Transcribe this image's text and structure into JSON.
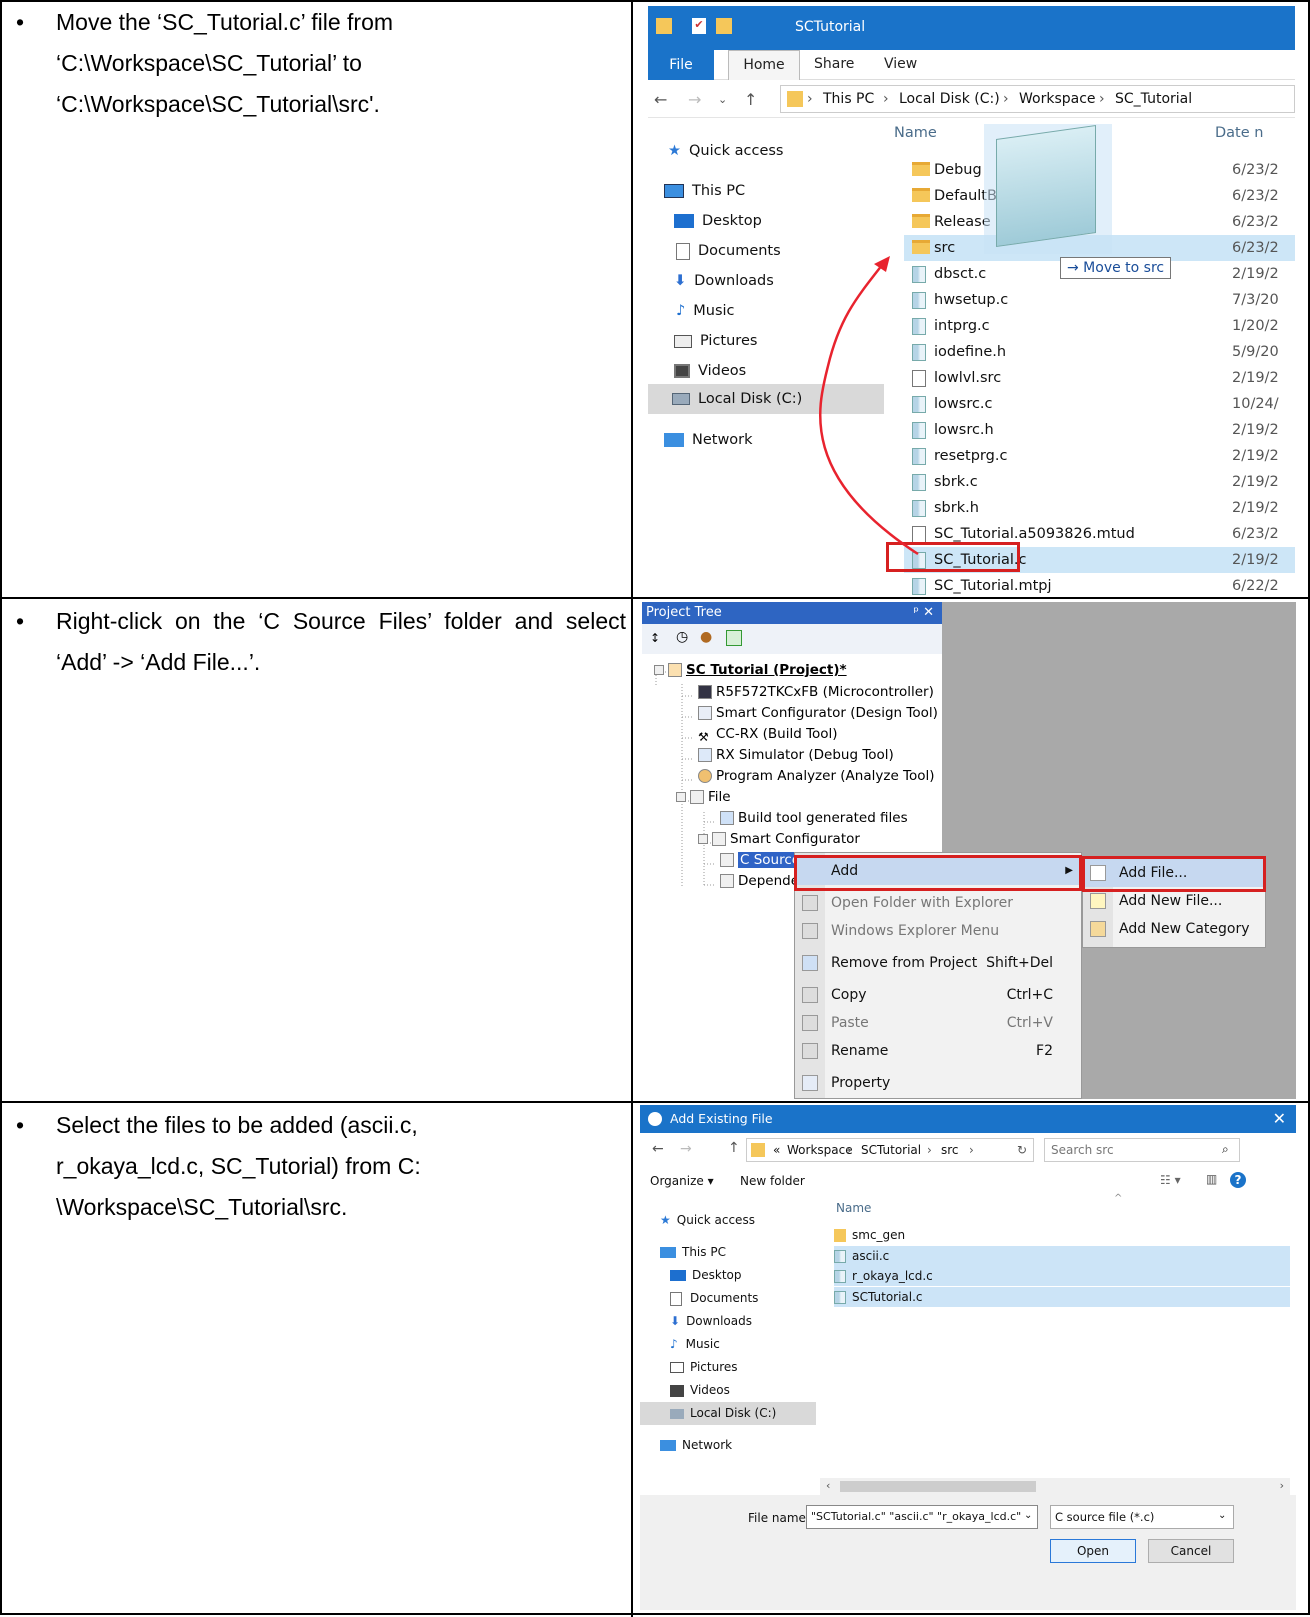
{
  "rows": [
    {
      "bullet": "•",
      "text": "Move the ‘SC_Tutorial.c’ file from ‘C:\\Workspace\\SC_Tutorial’ to ‘C:\\Workspace\\SC_Tutorial\\src'."
    },
    {
      "bullet": "•",
      "text": "Right-click on the ‘C Source Files’ folder and select ‘Add’ -> ‘Add File...’."
    },
    {
      "bullet": "•",
      "text": "Select the files to be added (ascii.c, r_okaya_lcd.c, SC_Tutorial) from C: \\Workspace\\SC_Tutorial\\src."
    }
  ],
  "explorer": {
    "title": "SCTutorial",
    "tabs": [
      "File",
      "Home",
      "Share",
      "View"
    ],
    "breadcrumb": [
      "This PC",
      "Local Disk (C:)",
      "Workspace",
      "SC_Tutorial"
    ],
    "nav": [
      "Quick access",
      "This PC",
      "Desktop",
      "Documents",
      "Downloads",
      "Music",
      "Pictures",
      "Videos",
      "Local Disk (C:)",
      "Network"
    ],
    "col_name": "Name",
    "col_date": "Date n",
    "tooltip": "→ Move to src",
    "files": [
      {
        "name": "Debug",
        "date": "6/23/2"
      },
      {
        "name": "DefaultBuild",
        "date": "6/23/2"
      },
      {
        "name": "Release",
        "date": "6/23/2"
      },
      {
        "name": "src",
        "date": "6/23/2"
      },
      {
        "name": "dbsct.c",
        "date": "2/19/2"
      },
      {
        "name": "hwsetup.c",
        "date": "7/3/20"
      },
      {
        "name": "intprg.c",
        "date": "1/20/2"
      },
      {
        "name": "iodefine.h",
        "date": "5/9/20"
      },
      {
        "name": "lowlvl.src",
        "date": "2/19/2"
      },
      {
        "name": "lowsrc.c",
        "date": "10/24/"
      },
      {
        "name": "lowsrc.h",
        "date": "2/19/2"
      },
      {
        "name": "resetprg.c",
        "date": "2/19/2"
      },
      {
        "name": "sbrk.c",
        "date": "2/19/2"
      },
      {
        "name": "sbrk.h",
        "date": "2/19/2"
      },
      {
        "name": "SC_Tutorial.a5093826.mtud",
        "date": "6/23/2"
      },
      {
        "name": "SC_Tutorial.c",
        "date": "2/19/2"
      },
      {
        "name": "SC_Tutorial.mtpj",
        "date": "6/22/2"
      }
    ]
  },
  "project_tree": {
    "title": "Project Tree",
    "pin": "ᵖ ✕",
    "items": [
      "SC Tutorial (Project)*",
      "R5F572TKCxFB (Microcontroller)",
      "Smart Configurator (Design Tool)",
      "CC-RX (Build Tool)",
      "RX Simulator (Debug Tool)",
      "Program Analyzer (Analyze Tool)",
      "File",
      "Build tool generated files",
      "Smart Configurator",
      "C Source Fil",
      "Dependenci"
    ],
    "menu": [
      {
        "label": "Add",
        "shortcut": ""
      },
      {
        "label": "Open Folder with Explorer",
        "shortcut": ""
      },
      {
        "label": "Windows Explorer Menu",
        "shortcut": ""
      },
      {
        "label": "Remove from Project",
        "shortcut": "Shift+Del"
      },
      {
        "label": "Copy",
        "shortcut": "Ctrl+C"
      },
      {
        "label": "Paste",
        "shortcut": "Ctrl+V"
      },
      {
        "label": "Rename",
        "shortcut": "F2"
      },
      {
        "label": "Property",
        "shortcut": ""
      }
    ],
    "submenu": [
      "Add File...",
      "Add New File...",
      "Add New Category"
    ]
  },
  "dialog": {
    "title": "Add Existing File",
    "breadcrumb": [
      "«",
      "Workspace",
      "SCTutorial",
      "src"
    ],
    "search_placeholder": "Search src",
    "organize": "Organize ▾",
    "new_folder": "New folder",
    "col_name": "Name",
    "nav": [
      "Quick access",
      "This PC",
      "Desktop",
      "Documents",
      "Downloads",
      "Music",
      "Pictures",
      "Videos",
      "Local Disk (C:)",
      "Network"
    ],
    "files": [
      "smc_gen",
      "ascii.c",
      "r_okaya_lcd.c",
      "SCTutorial.c"
    ],
    "file_name_label": "File name:",
    "file_name_value": "\"SCTutorial.c\" \"ascii.c\" \"r_okaya_lcd.c\"",
    "file_type": "C source file (*.c)",
    "open": "Open",
    "cancel": "Cancel"
  }
}
